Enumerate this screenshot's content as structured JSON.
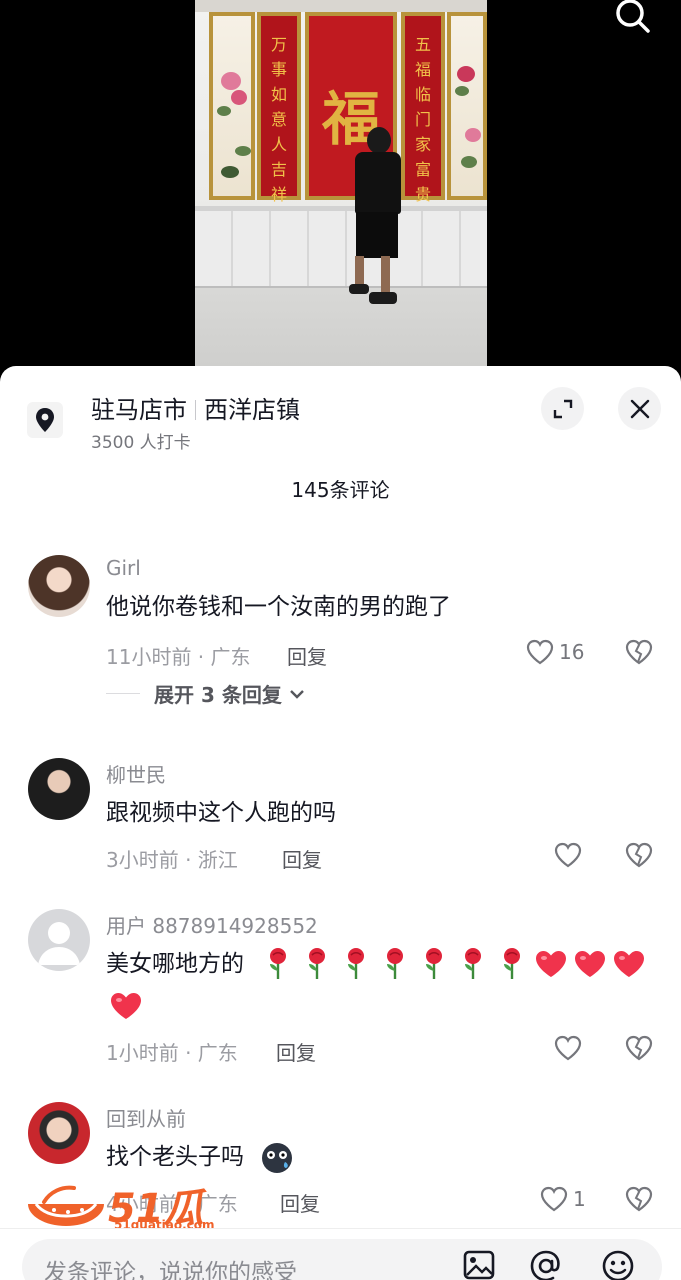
{
  "video": {
    "couplet_left": "万事如意人吉祥",
    "couplet_right": "五福临门家富贵",
    "center_char": "福"
  },
  "location": {
    "name": "驻马店市",
    "sub_area": "西洋店镇",
    "checkins": "3500 人打卡"
  },
  "comments_header": {
    "title": "145条评论"
  },
  "comments": [
    {
      "user": "Girl",
      "text": "他说你卷钱和一个汝南的男的跑了",
      "meta": "11小时前 · 广东",
      "reply": "回复",
      "likes": "16",
      "expand": "展开 3 条回复"
    },
    {
      "user": "柳世民",
      "text": "跟视频中这个人跑的吗",
      "meta": "3小时前 · 浙江",
      "reply": "回复",
      "likes": ""
    },
    {
      "user": "用户 8878914928552",
      "text": "美女哪地方的",
      "meta": "1小时前 · 广东",
      "reply": "回复",
      "likes": ""
    },
    {
      "user": "回到从前",
      "text": "找个老头子吗",
      "meta": "4小时前 · 广东",
      "reply": "回复",
      "likes": "1"
    }
  ],
  "watermark": {
    "brand": "51瓜条",
    "url": "51guatiao.com"
  },
  "input": {
    "placeholder": "发条评论，说说你的感受"
  },
  "colors": {
    "heart_red": "#f0334c",
    "watermark_orange": "#f0622a",
    "couplet_red": "#b0141b",
    "gold": "#b8933b"
  },
  "icons": [
    "search-icon",
    "location-pin-icon",
    "expand-icon",
    "close-icon",
    "heart-icon",
    "broken-heart-icon",
    "chevron-down-icon",
    "image-icon",
    "at-icon",
    "emoji-icon",
    "rose-emoji",
    "red-heart-emoji",
    "grimace-emoji"
  ]
}
